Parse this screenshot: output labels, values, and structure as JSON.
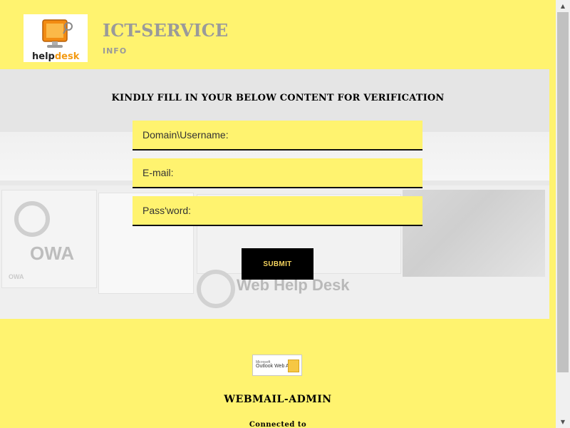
{
  "header": {
    "logo_text_main": "help",
    "logo_text_accent": "desk",
    "title": "ICT-SERVICE",
    "subtitle": "INFO"
  },
  "hero": {
    "collage_owa": "OWA",
    "collage_owa_small": "OWA",
    "collage_whd": "Web Help Desk"
  },
  "form": {
    "title": "KINDLY FILL IN YOUR BELOW CONTENT FOR VERIFICATION",
    "username_placeholder": "Domain\\Username:",
    "email_placeholder": "E-mail:",
    "password_placeholder": "Pass'word:",
    "submit_label": "SUBMIT"
  },
  "footer": {
    "badge_small": "Microsoft",
    "badge_text": "Outlook Web App",
    "title": "WEBMAIL-ADMIN",
    "subtitle": "Connected to"
  },
  "colors": {
    "background": "#fff36f",
    "button": "#000000",
    "button_text": "#f4d35e",
    "title_gray": "#9a9a9a"
  },
  "icons": [
    "helpdesk-computer-icon",
    "outlook-envelope-icon",
    "arrow-up-icon",
    "arrow-down-icon"
  ]
}
